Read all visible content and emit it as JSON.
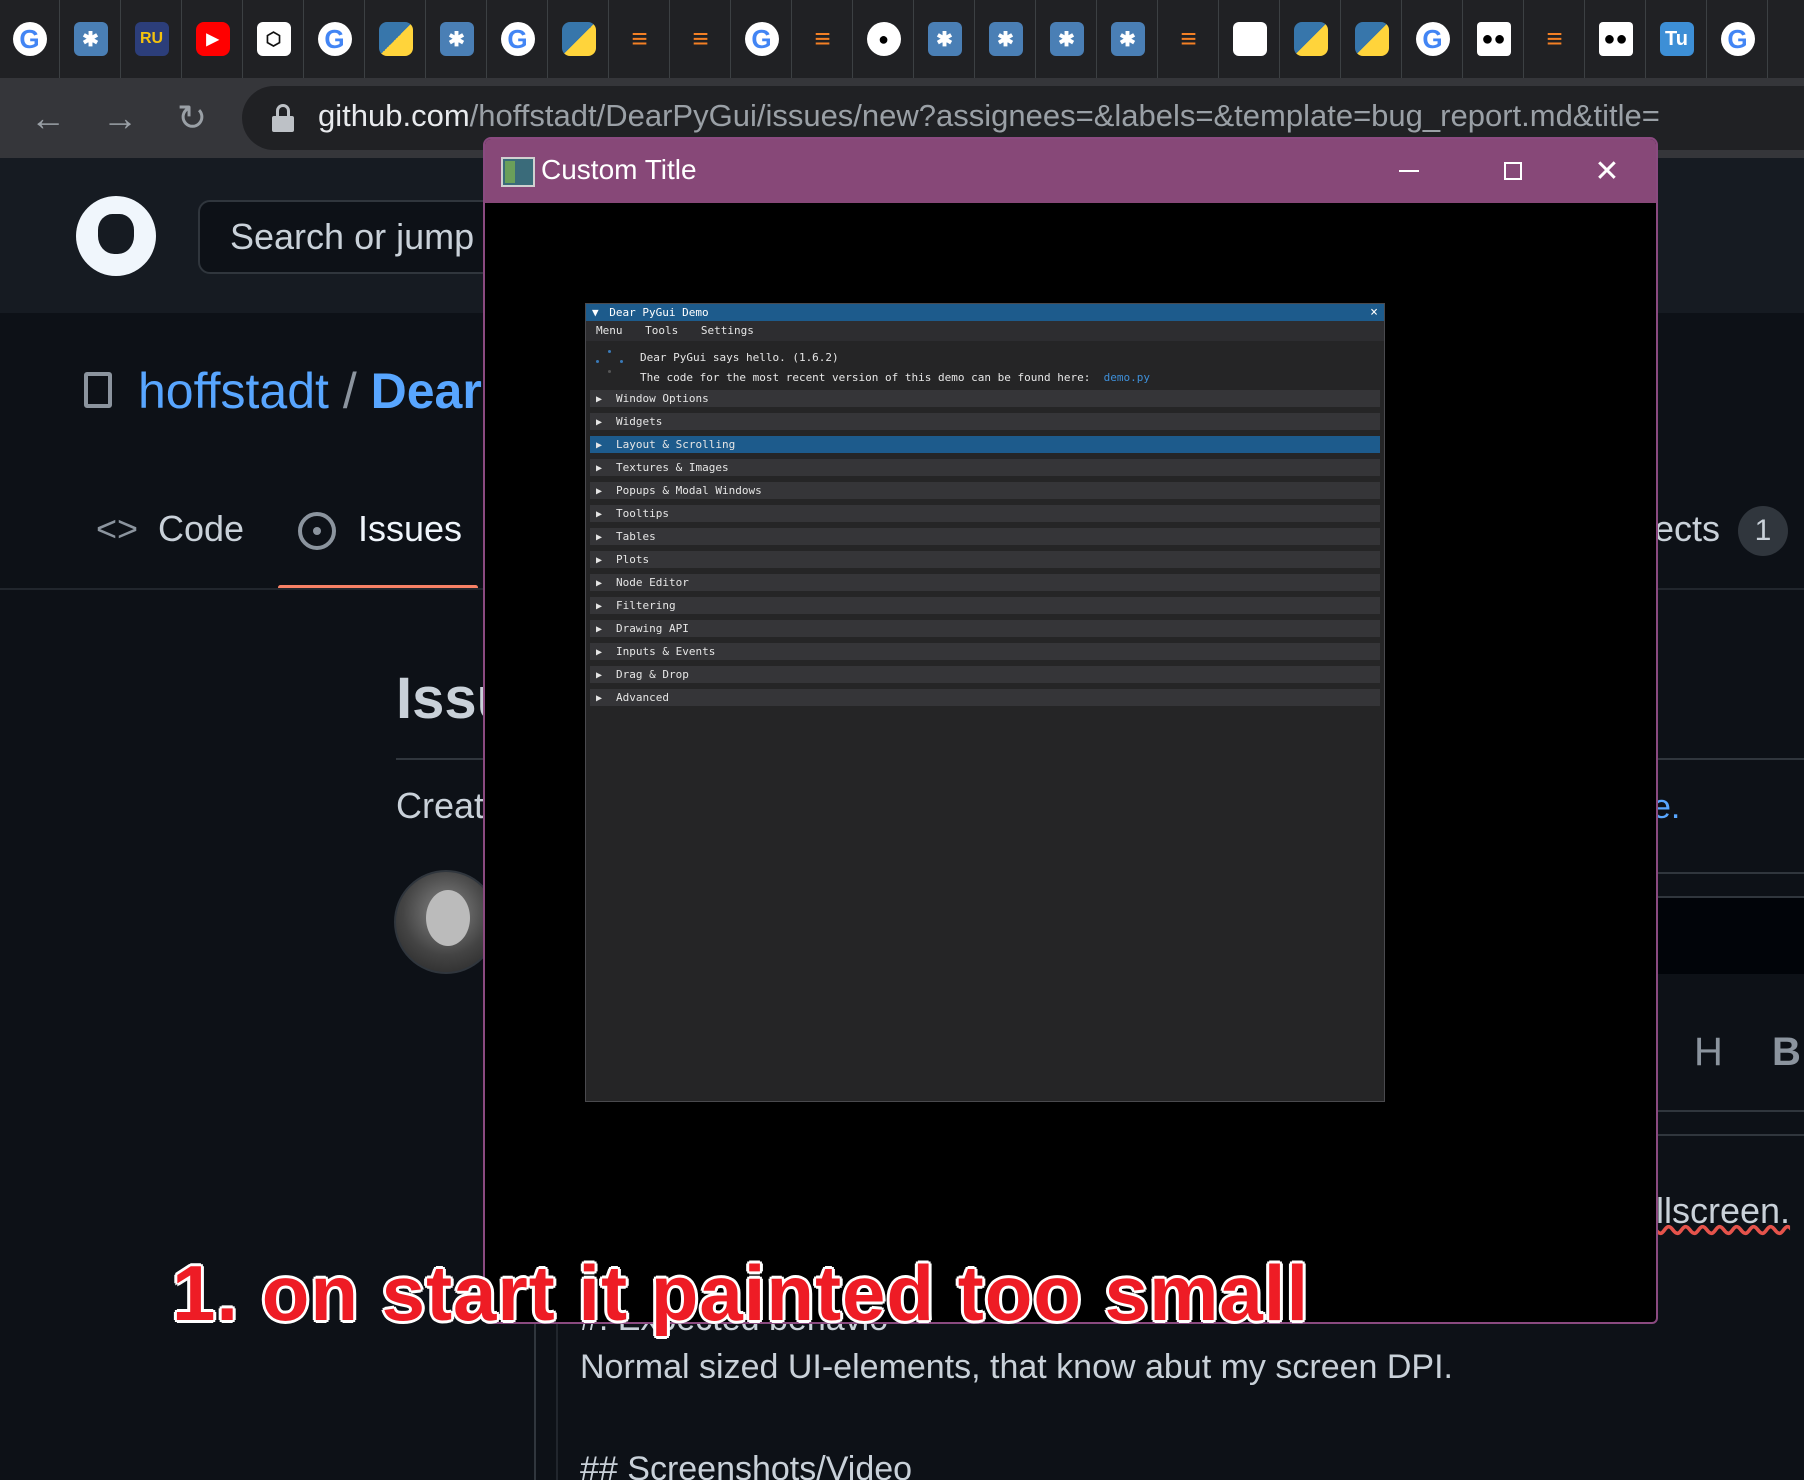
{
  "browser": {
    "tabs": [
      {
        "icon": "google-icon",
        "glyph": "G",
        "style": "google"
      },
      {
        "icon": "extension-icon",
        "glyph": "✱",
        "style": "ext"
      },
      {
        "icon": "ru-icon",
        "glyph": "RU",
        "style": "ru"
      },
      {
        "icon": "youtube-icon",
        "glyph": "▶",
        "style": "yt"
      },
      {
        "icon": "openai-icon",
        "glyph": "⬡",
        "style": "ai"
      },
      {
        "icon": "google-icon",
        "glyph": "G",
        "style": "google"
      },
      {
        "icon": "python-icon",
        "glyph": "",
        "style": "py"
      },
      {
        "icon": "extension-icon",
        "glyph": "✱",
        "style": "ext"
      },
      {
        "icon": "google-icon",
        "glyph": "G",
        "style": "google"
      },
      {
        "icon": "python-icon",
        "glyph": "",
        "style": "py"
      },
      {
        "icon": "stackoverflow-icon",
        "glyph": "≡",
        "style": "so"
      },
      {
        "icon": "stackoverflow-icon",
        "glyph": "≡",
        "style": "so"
      },
      {
        "icon": "google-icon",
        "glyph": "G",
        "style": "google"
      },
      {
        "icon": "stackoverflow-icon",
        "glyph": "≡",
        "style": "so"
      },
      {
        "icon": "github-icon",
        "glyph": "●",
        "style": "gh"
      },
      {
        "icon": "extension-icon",
        "glyph": "✱",
        "style": "ext"
      },
      {
        "icon": "extension-icon",
        "glyph": "✱",
        "style": "ext"
      },
      {
        "icon": "extension-icon",
        "glyph": "✱",
        "style": "ext"
      },
      {
        "icon": "extension-icon",
        "glyph": "✱",
        "style": "ext"
      },
      {
        "icon": "stackoverflow-icon",
        "glyph": "≡",
        "style": "so"
      },
      {
        "icon": "python-org-icon",
        "glyph": "",
        "style": "pyw"
      },
      {
        "icon": "python-icon",
        "glyph": "",
        "style": "py"
      },
      {
        "icon": "python-icon",
        "glyph": "",
        "style": "py"
      },
      {
        "icon": "google-icon",
        "glyph": "G",
        "style": "google"
      },
      {
        "icon": "medium-icon",
        "glyph": "●●",
        "style": "md"
      },
      {
        "icon": "stackoverflow-icon",
        "glyph": "≡",
        "style": "so"
      },
      {
        "icon": "medium-icon",
        "glyph": "●●",
        "style": "md"
      },
      {
        "icon": "tu-icon",
        "glyph": "Tu",
        "style": "tu"
      },
      {
        "icon": "google-icon",
        "glyph": "G",
        "style": "google"
      }
    ],
    "url_host": "github.com",
    "url_path": "/hoffstadt/DearPyGui/issues/new?assignees=&labels=&template=bug_report.md&title="
  },
  "github": {
    "search_placeholder": "Search or jump t",
    "repo_owner": "hoffstadt",
    "repo_sep": "/",
    "repo_name_fragment": "Dear",
    "tab_code": "Code",
    "tab_issues": "Issues",
    "tab_projects_fragment": "ects",
    "projects_count": "1",
    "issue_title_fragment": "Issu",
    "create_fragment": "Create",
    "link_fragment": "e.",
    "tool_h": "H",
    "tool_b": "B",
    "fullscreen_fragment": "llscreen.",
    "expected_fragment": "#. Expected behavio",
    "normal_text": "Normal sized UI-elements, that know abut my screen DPI.",
    "screenshots_fragment": "## Screenshots/Video"
  },
  "custom_window": {
    "title": "Custom Title",
    "min_label": "",
    "max_label": "",
    "close_label": "✕"
  },
  "dpg_demo": {
    "title": "Dear PyGui Demo",
    "collapse_glyph": "▼",
    "close_glyph": "×",
    "menus": [
      "Menu",
      "Tools",
      "Settings"
    ],
    "hello_line": "Dear PyGui says hello. (1.6.2)",
    "code_line": "The code for the most recent version of this demo can be found here:",
    "code_link": "demo.py",
    "sections": [
      {
        "label": "Window Options",
        "active": false
      },
      {
        "label": "Widgets",
        "active": false
      },
      {
        "label": "Layout & Scrolling",
        "active": true
      },
      {
        "label": "Textures & Images",
        "active": false
      },
      {
        "label": "Popups & Modal Windows",
        "active": false
      },
      {
        "label": "Tooltips",
        "active": false
      },
      {
        "label": "Tables",
        "active": false
      },
      {
        "label": "Plots",
        "active": false
      },
      {
        "label": "Node Editor",
        "active": false
      },
      {
        "label": "Filtering",
        "active": false
      },
      {
        "label": "Drawing API",
        "active": false
      },
      {
        "label": "Inputs & Events",
        "active": false
      },
      {
        "label": "Drag & Drop",
        "active": false
      },
      {
        "label": "Advanced",
        "active": false
      }
    ]
  },
  "annotation": "1. on start it painted too small",
  "colors": {
    "titlebar_purple": "#874878",
    "dpg_blue": "#1d5b8c",
    "annotation_red": "#ee1c25",
    "github_bg": "#0d1117"
  }
}
